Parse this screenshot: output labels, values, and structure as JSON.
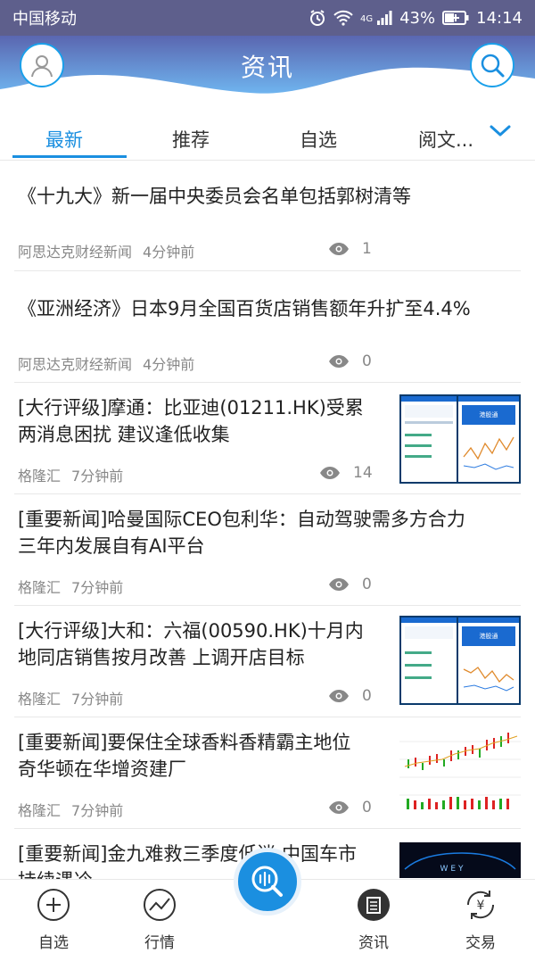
{
  "status_bar": {
    "carrier": "中国移动",
    "network": "4G",
    "battery": "43%",
    "time": "14:14"
  },
  "header": {
    "title": "资讯"
  },
  "tabs": [
    {
      "label": "最新"
    },
    {
      "label": "推荐"
    },
    {
      "label": "自选"
    },
    {
      "label": "阅文..."
    }
  ],
  "news": [
    {
      "headline_1": "《十九大》新一届中央委员会名单包括郭树清等",
      "source": "阿思达克财经新闻",
      "time": "4分钟前",
      "views": "1"
    },
    {
      "headline_1": "《亚洲经济》日本9月全国百货店销售额年升扩至4.4%",
      "source": "阿思达克财经新闻",
      "time": "4分钟前",
      "views": "0"
    },
    {
      "headline_1": "[大行评级]摩通：比亚迪(01211.HK)受累",
      "headline_2": "两消息困扰 建议逢低收集",
      "source": "格隆汇",
      "time": "7分钟前",
      "views": "14"
    },
    {
      "headline_1": "[重要新闻]哈曼国际CEO包利华：自动驾驶需多方合力",
      "headline_2": "三年内发展自有AI平台",
      "source": "格隆汇",
      "time": "7分钟前",
      "views": "0"
    },
    {
      "headline_1": "[大行评级]大和：六福(00590.HK)十月内",
      "headline_2": "地同店销售按月改善 上调开店目标",
      "source": "格隆汇",
      "time": "7分钟前",
      "views": "0"
    },
    {
      "headline_1": "[重要新闻]要保住全球香料香精霸主地位",
      "headline_2": "奇华顿在华增资建厂",
      "source": "格隆汇",
      "time": "7分钟前",
      "views": "0"
    },
    {
      "headline_1": "[重要新闻]金九难救三季度低迷 中国车市",
      "headline_2": "持续遇冷"
    }
  ],
  "thumbs": {
    "app_name": "港股通",
    "car_logo": "WEY"
  },
  "bottom_nav": [
    {
      "label": "自选"
    },
    {
      "label": "行情"
    },
    {
      "label": "资讯"
    },
    {
      "label": "交易"
    }
  ],
  "colors": {
    "accent": "#1a8fe0",
    "status_bar": "#5e5f8c"
  }
}
